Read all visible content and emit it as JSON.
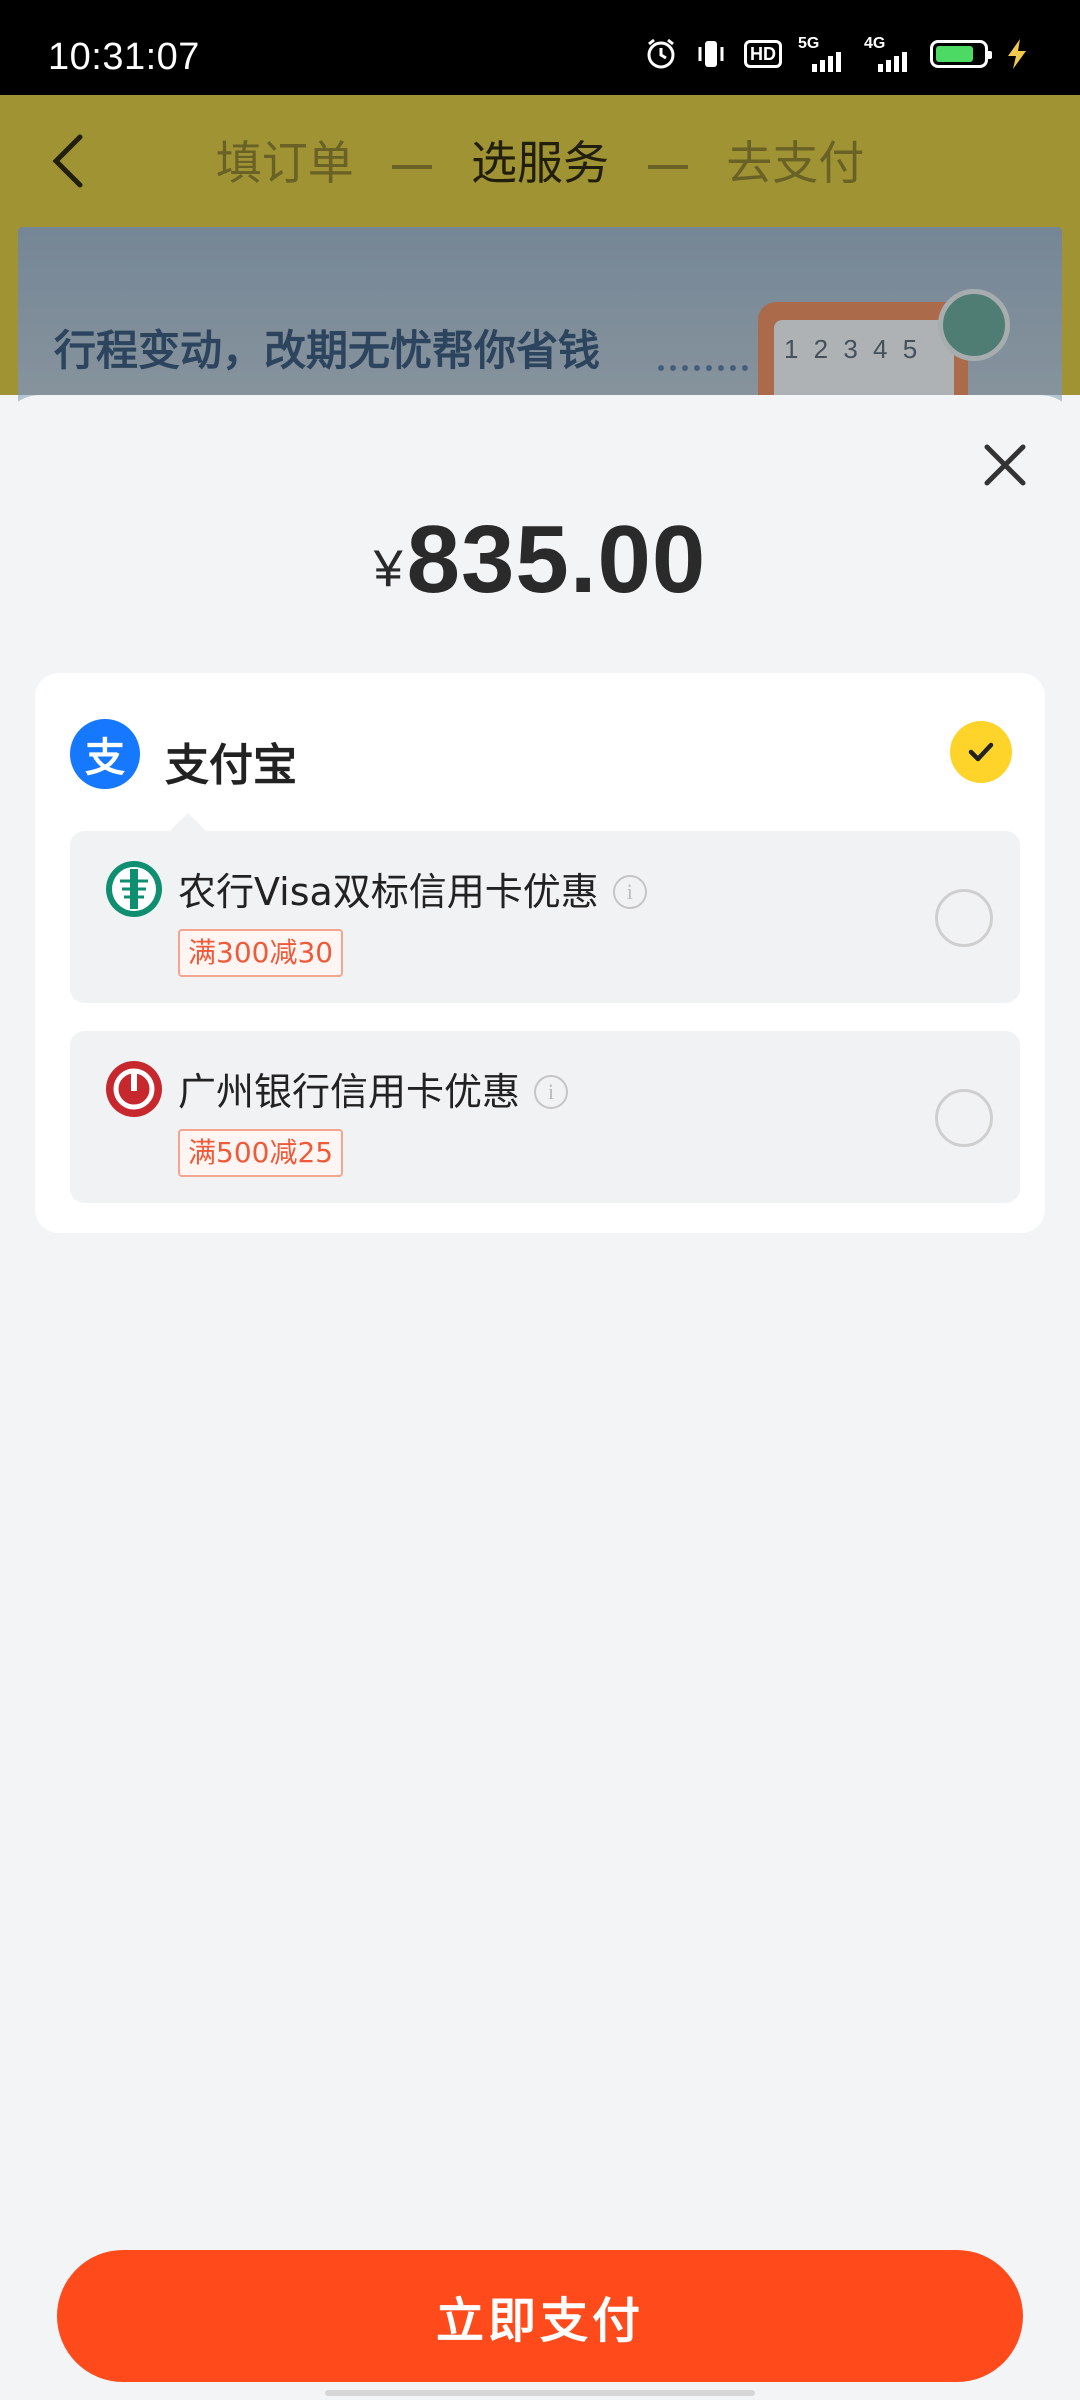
{
  "status_bar": {
    "time": "10:31:07",
    "hd_label": "HD",
    "network_1": "5G",
    "network_2": "4G",
    "battery_percent": 80
  },
  "header": {
    "steps": [
      "填订单",
      "选服务",
      "去支付"
    ],
    "active_step": 1
  },
  "banner": {
    "text": "行程变动，改期无忧帮你省钱",
    "calendar_numbers": "1 2 3 4 5"
  },
  "payment_sheet": {
    "currency_symbol": "¥",
    "amount": "835.00",
    "method": {
      "label": "支付宝",
      "logo_char": "支",
      "selected": true
    },
    "offers": [
      {
        "title": "农行Visa双标信用卡优惠",
        "tag": "满300减30",
        "bank_icon": "abc-bank-icon",
        "selected": false
      },
      {
        "title": "广州银行信用卡优惠",
        "tag": "满500减25",
        "bank_icon": "guangzhou-bank-icon",
        "selected": false
      }
    ],
    "info_glyph": "i"
  },
  "pay_button": {
    "label": "立即支付"
  },
  "colors": {
    "primary_button": "#ff4a1c",
    "alipay_blue": "#1677ff",
    "check_yellow": "#ffd42a",
    "tag_red": "#ef5a3a"
  }
}
